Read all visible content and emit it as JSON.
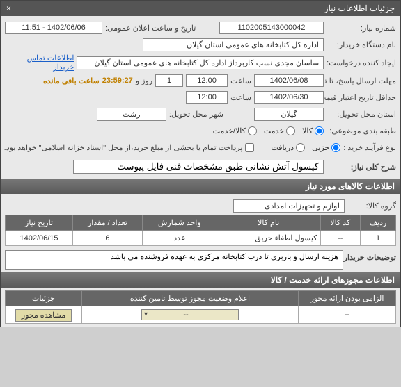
{
  "title": "جزئیات اطلاعات نیاز",
  "labels": {
    "need_no": "شماره نیاز:",
    "announce_dt": "تاریخ و ساعت اعلان عمومی:",
    "buyer_org": "نام دستگاه خریدار:",
    "requester": "ایجاد کننده درخواست:",
    "contact_link": "اطلاعات تماس خریدار",
    "reply_deadline": "مهلت ارسال پاسخ، تا تاریخ:",
    "hour": "ساعت",
    "days": "روز و",
    "remaining": "ساعت باقی مانده",
    "min_validity": "حداقل تاریخ اعتبار قیمت، تا تاریخ:",
    "delivery_province": "استان محل تحویل:",
    "delivery_city": "شهر محل تحویل:",
    "subject_class": "طبقه بندی موضوعی:",
    "kala": "کالا",
    "khadamat": "خدمت",
    "kala_khadamat": "کالا/خدمت",
    "buy_type": "نوع فرآیند خرید :",
    "full": "جزیی",
    "partial": "دریافت",
    "payment_note": "پرداخت تمام یا بخشی از مبلغ خرید،از محل \"اسناد خزانه اسلامی\" خواهد بود.",
    "need_desc": "شرح کلی نیاز:",
    "items_header": "اطلاعات کالاهای مورد نیاز",
    "goods_group": "گروه کالا:",
    "buyer_notes": "توضیحات خریدار:",
    "auth_header": "اطلاعات مجوزهای ارائه خدمت / کالا",
    "col_row": "ردیف",
    "col_code": "کد کالا",
    "col_name": "نام کالا",
    "col_unit": "واحد شمارش",
    "col_qty": "تعداد / مقدار",
    "col_date": "تاریخ نیاز",
    "col2_required": "الزامی بودن ارائه مجوز",
    "col2_status": "اعلام وضعیت مجوز توسط تامین کننده",
    "col2_details": "جزئیات",
    "view_auth_btn": "مشاهده مجوز",
    "sel_placeholder": "--"
  },
  "values": {
    "need_no": "1102005143000042",
    "announce_dt": "1402/06/06 - 11:51",
    "buyer_org": "اداره کل کتابخانه های عمومی استان گیلان",
    "requester": "ساسان مجدی نسب کاربرداز اداره کل کتابخانه های عمومی استان گیلان",
    "reply_date": "1402/06/08",
    "reply_time": "12:00",
    "days_left": "1",
    "time_left": "23:59:27",
    "valid_date": "1402/06/30",
    "valid_time": "12:00",
    "province": "گیلان",
    "city": "رشت",
    "need_desc": "کپسول آتش نشانی طبق مشخصات فنی فایل پیوست",
    "goods_group": "لوازم و تجهیزات امدادی",
    "buyer_notes": "هزینه ارسال و باربری تا درب کتابخانه مرکزی به عهده فروشنده می باشد",
    "auth_required": "--"
  },
  "items": [
    {
      "row": "1",
      "code": "--",
      "name": "کپسول اطفاء حریق",
      "unit": "عدد",
      "qty": "6",
      "date": "1402/06/15"
    }
  ],
  "chart_data": {
    "type": "table",
    "title": "اطلاعات کالاهای مورد نیاز",
    "columns": [
      "ردیف",
      "کد کالا",
      "نام کالا",
      "واحد شمارش",
      "تعداد / مقدار",
      "تاریخ نیاز"
    ],
    "rows": [
      [
        "1",
        "--",
        "کپسول اطفاء حریق",
        "عدد",
        "6",
        "1402/06/15"
      ]
    ]
  }
}
